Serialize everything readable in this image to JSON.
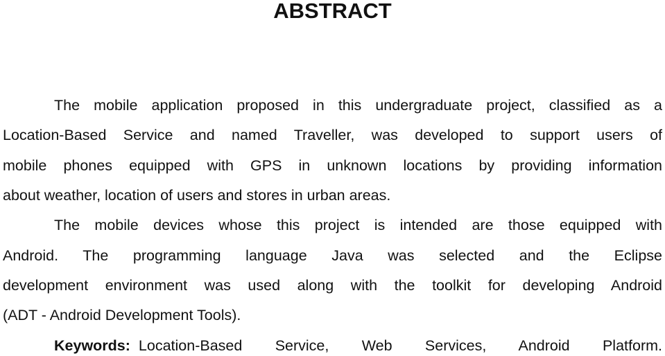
{
  "document": {
    "title": "ABSTRACT",
    "paragraph1_lines": [
      "The mobile application proposed in this undergraduate project, classified as a",
      "Location-Based Service and named Traveller, was developed to support users of",
      "mobile phones equipped with GPS in unknown locations by providing information",
      "about weather, location of users and stores in urban areas."
    ],
    "paragraph2_lines": [
      "The mobile devices whose this project is intended are those equipped with",
      "Android. The programming language Java was selected and the Eclipse",
      "development environment was used along with the toolkit for developing Android",
      "(ADT - Android Development Tools)."
    ],
    "keywords_label": "Keywords:",
    "keywords_text": "Location-Based Service, Web Services, Android Platform."
  }
}
